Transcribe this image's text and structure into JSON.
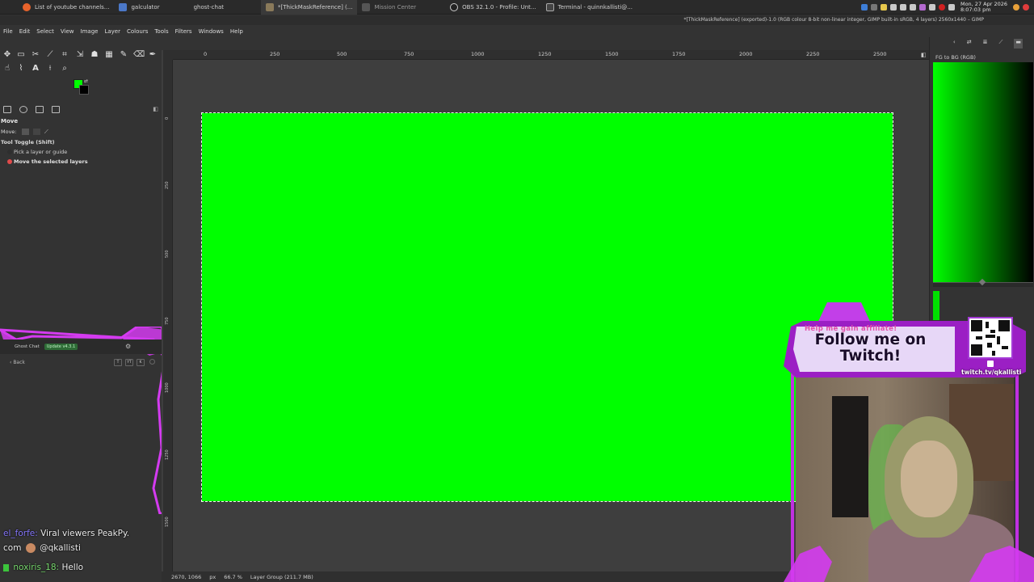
{
  "taskbar": {
    "tasks": [
      {
        "label": "List of youtube channels..."
      },
      {
        "label": "galculator"
      },
      {
        "label": "ghost-chat"
      },
      {
        "label": "*[ThickMaskReference] (..."
      },
      {
        "label": "Mission Center"
      },
      {
        "label": "OBS 32.1.0 - Profile: Unt..."
      },
      {
        "label": "Terminal - quinnkallisti@..."
      }
    ],
    "clock_date": "Mon, 27 Apr 2026",
    "clock_time": "8:07:03 pm"
  },
  "gimp": {
    "title": "*[ThickMaskReference] (exported)-1.0 (RGB colour 8-bit non-linear integer, GIMP built-in sRGB, 4 layers) 2560x1440 – GIMP",
    "menu": [
      "File",
      "Edit",
      "Select",
      "View",
      "Image",
      "Layer",
      "Colours",
      "Tools",
      "Filters",
      "Windows",
      "Help"
    ],
    "ruler_labels": [
      "0",
      "250",
      "500",
      "750",
      "1000",
      "1250",
      "1500",
      "1750",
      "2000",
      "2250",
      "2500"
    ],
    "vruler_labels": [
      "0",
      "250",
      "500",
      "750",
      "1000",
      "1250",
      "1500"
    ],
    "tool_options": {
      "title": "Move",
      "move_label": "Move:",
      "toggle_label": "Tool Toggle (Shift)",
      "option_pick": "Pick a layer or guide",
      "option_move": "Move the selected layers"
    },
    "statusbar": {
      "coords": "2670, 1066",
      "unit": "px",
      "zoom": "66.7 %",
      "layer_info": "Layer Group (211.7 MB)"
    },
    "dock": {
      "gradient_label": "FG to BG (RGB)"
    },
    "colors": {
      "canvas": "#00ff00",
      "foreground": "#00ff00",
      "background": "#000000"
    }
  },
  "ghost_chat": {
    "app_name": "Ghost Chat",
    "update_badge": "Update v4.3.1",
    "back_label": "Back",
    "btn_t": "T",
    "btn_yt": "YT",
    "btn_k": "K"
  },
  "chat": {
    "messages": [
      {
        "user": "el_forfe:",
        "text": "Viral viewers PeakPy."
      },
      {
        "user": "com",
        "text": "@qkallisti"
      },
      {
        "user": "noxiris_18:",
        "text": "Hello"
      }
    ]
  },
  "overlay": {
    "subtitle": "Help me gain affiliate!",
    "follow_line1": "Follow me on",
    "follow_line2": "Twitch!",
    "url": "twitch.tv/qkallisti",
    "accent": "#c030e0"
  }
}
